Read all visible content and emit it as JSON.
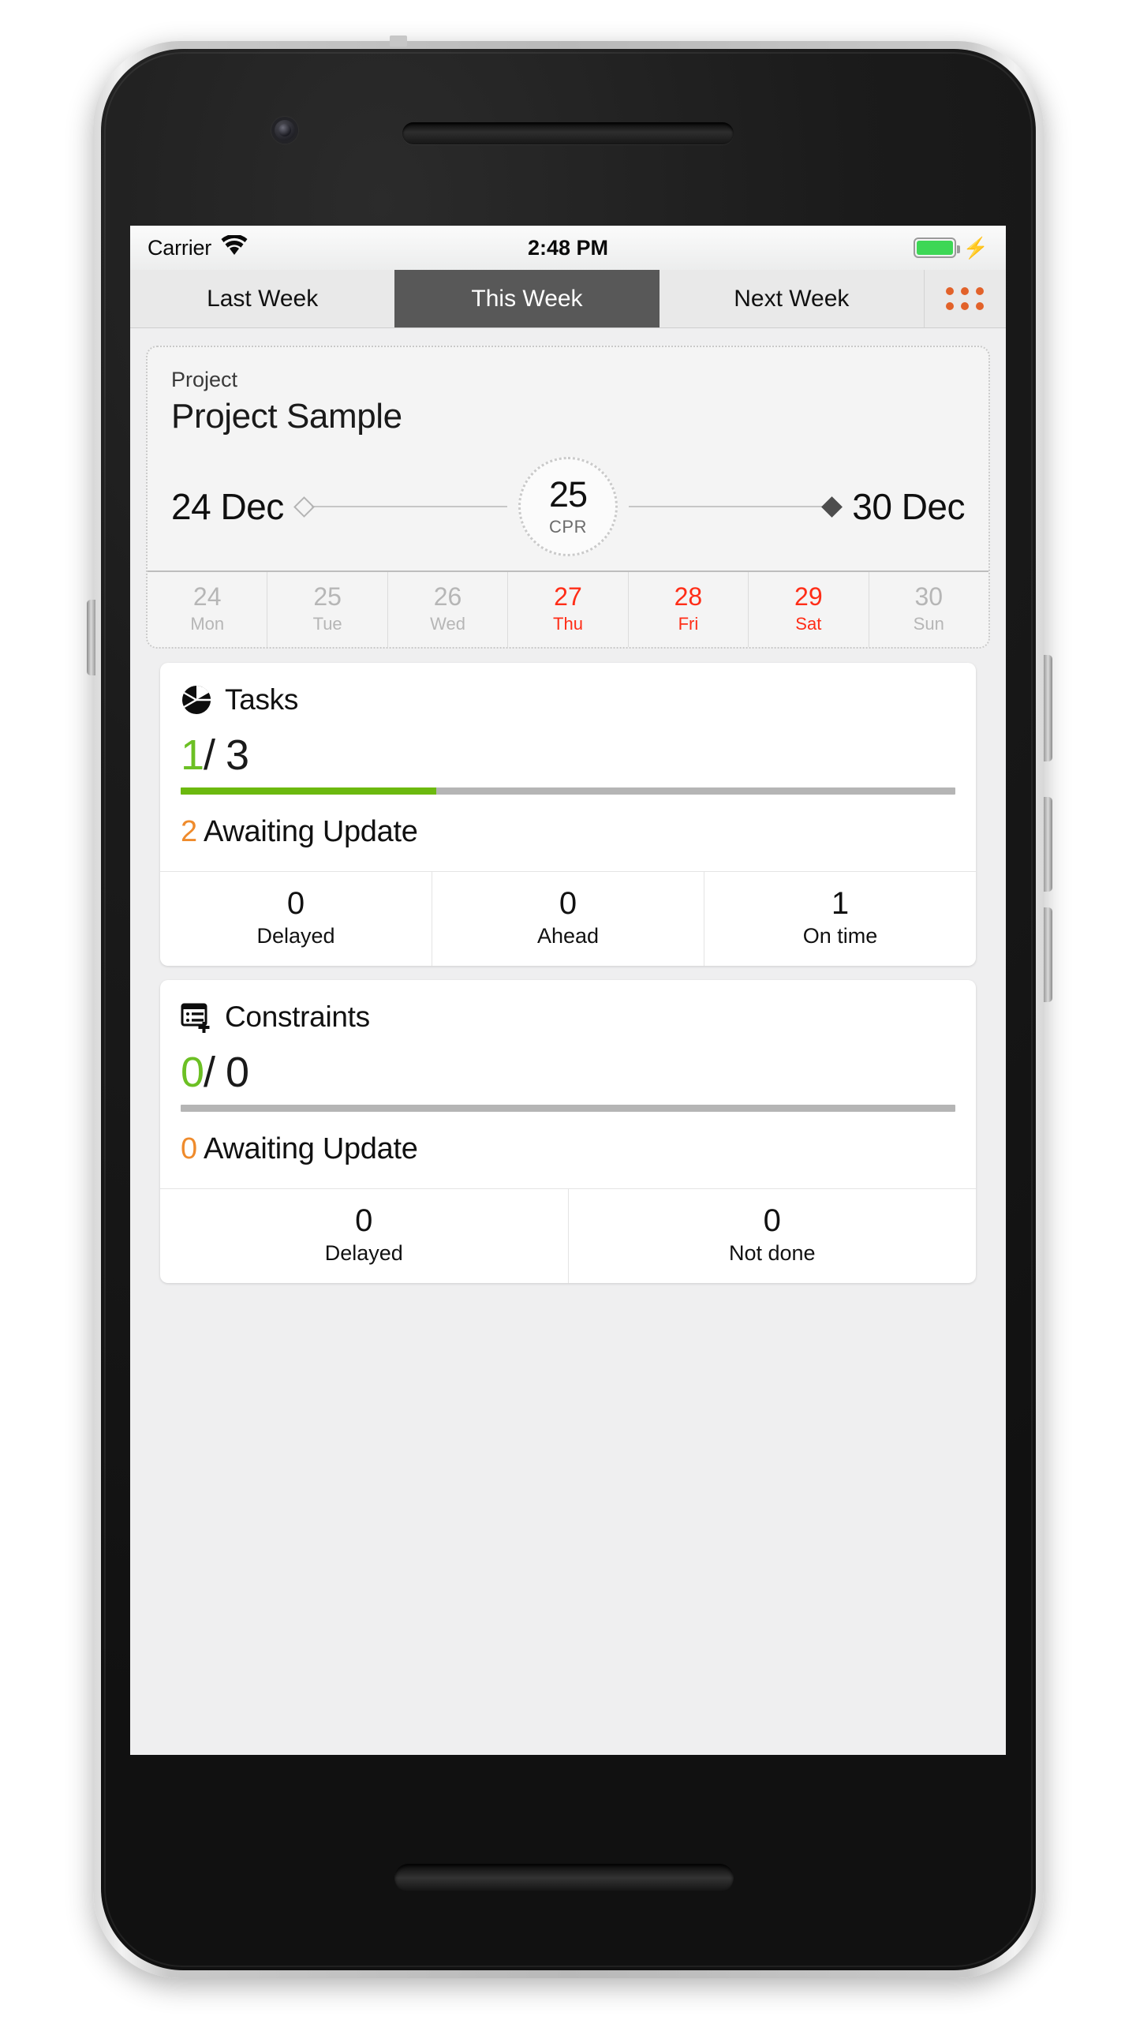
{
  "statusbar": {
    "carrier": "Carrier",
    "wifi_icon": "wifi-icon",
    "time": "2:48 PM",
    "battery_icon": "battery-full-icon",
    "charging_icon": "lightning-bolt-icon",
    "battery_level_pct": 100
  },
  "tabs": {
    "items": [
      {
        "label": "Last Week",
        "active": false
      },
      {
        "label": "This Week",
        "active": true
      },
      {
        "label": "Next Week",
        "active": false
      }
    ],
    "menu_icon": "grid-dots-icon",
    "menu_icon_color": "#e2622a",
    "active_bg": "#585858"
  },
  "project": {
    "label": "Project",
    "name": "Project Sample",
    "range": {
      "start": "24 Dec",
      "end": "30 Dec",
      "marker_number": "25",
      "marker_label": "CPR"
    },
    "days": [
      {
        "num": "24",
        "name": "Mon",
        "state": "muted"
      },
      {
        "num": "25",
        "name": "Tue",
        "state": "muted"
      },
      {
        "num": "26",
        "name": "Wed",
        "state": "muted"
      },
      {
        "num": "27",
        "name": "Thu",
        "state": "highlight"
      },
      {
        "num": "28",
        "name": "Fri",
        "state": "highlight"
      },
      {
        "num": "29",
        "name": "Sat",
        "state": "highlight"
      },
      {
        "num": "30",
        "name": "Sun",
        "state": "muted"
      }
    ]
  },
  "tasks_card": {
    "icon": "pie-chart-icon",
    "title": "Tasks",
    "done": "1",
    "total": "/ 3",
    "progress_pct": 33,
    "awaiting_count": "2",
    "awaiting_label": "Awaiting Update",
    "stats": [
      {
        "value": "0",
        "label": "Delayed"
      },
      {
        "value": "0",
        "label": "Ahead"
      },
      {
        "value": "1",
        "label": "On time"
      }
    ]
  },
  "constraints_card": {
    "icon": "list-add-icon",
    "title": "Constraints",
    "done": "0",
    "total": "/ 0",
    "progress_pct": 0,
    "awaiting_count": "0",
    "awaiting_label": "Awaiting Update",
    "stats": [
      {
        "value": "0",
        "label": "Delayed"
      },
      {
        "value": "0",
        "label": "Not done"
      }
    ]
  },
  "colors": {
    "green": "#6cb90f",
    "orange": "#ef8b2c",
    "accent_orange": "#e2622a",
    "red": "#ff2d17",
    "tab_active": "#585858"
  }
}
